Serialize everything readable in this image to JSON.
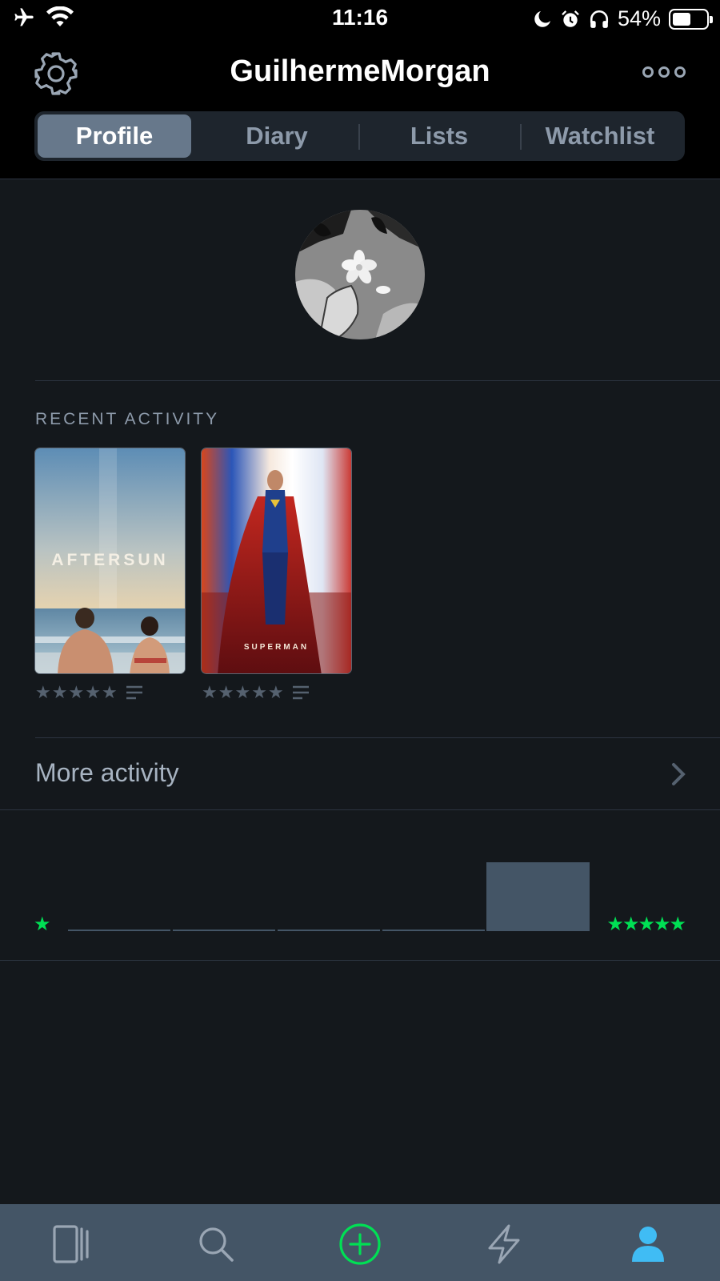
{
  "status_bar": {
    "time": "11:16",
    "battery_percent": "54%",
    "battery_level": 0.54,
    "icons": [
      "airplane-icon",
      "wifi-icon",
      "moon-icon",
      "alarm-icon",
      "headphones-icon",
      "battery-icon"
    ]
  },
  "header": {
    "username": "GuilhermeMorgan",
    "left_icon": "gear-icon",
    "right_icon": "more-icon"
  },
  "tabs": [
    {
      "label": "Profile",
      "active": true
    },
    {
      "label": "Diary",
      "active": false
    },
    {
      "label": "Lists",
      "active": false
    },
    {
      "label": "Watchlist",
      "active": false
    }
  ],
  "recent_activity": {
    "heading": "RECENT ACTIVITY",
    "films": [
      {
        "poster_text": "AFTERSUN",
        "rating_stars": 5,
        "has_review": true
      },
      {
        "poster_text": "SUPERMAN",
        "rating_stars": 5,
        "has_review": true
      }
    ]
  },
  "more_activity": {
    "label": "More activity"
  },
  "ratings_histogram": {
    "low_label": "★",
    "high_label": "★★★★★",
    "bars": [
      0,
      0,
      0,
      0,
      1
    ]
  },
  "colors": {
    "background": "#14181c",
    "accent_green": "#00e054",
    "active_blue": "#40bcf4",
    "tabbar": "#445566",
    "segment_active": "#67788b"
  },
  "tab_bar": [
    {
      "icon": "films-icon",
      "active": false
    },
    {
      "icon": "search-icon",
      "active": false
    },
    {
      "icon": "add-icon",
      "active": false
    },
    {
      "icon": "activity-icon",
      "active": false
    },
    {
      "icon": "profile-icon",
      "active": true
    }
  ]
}
